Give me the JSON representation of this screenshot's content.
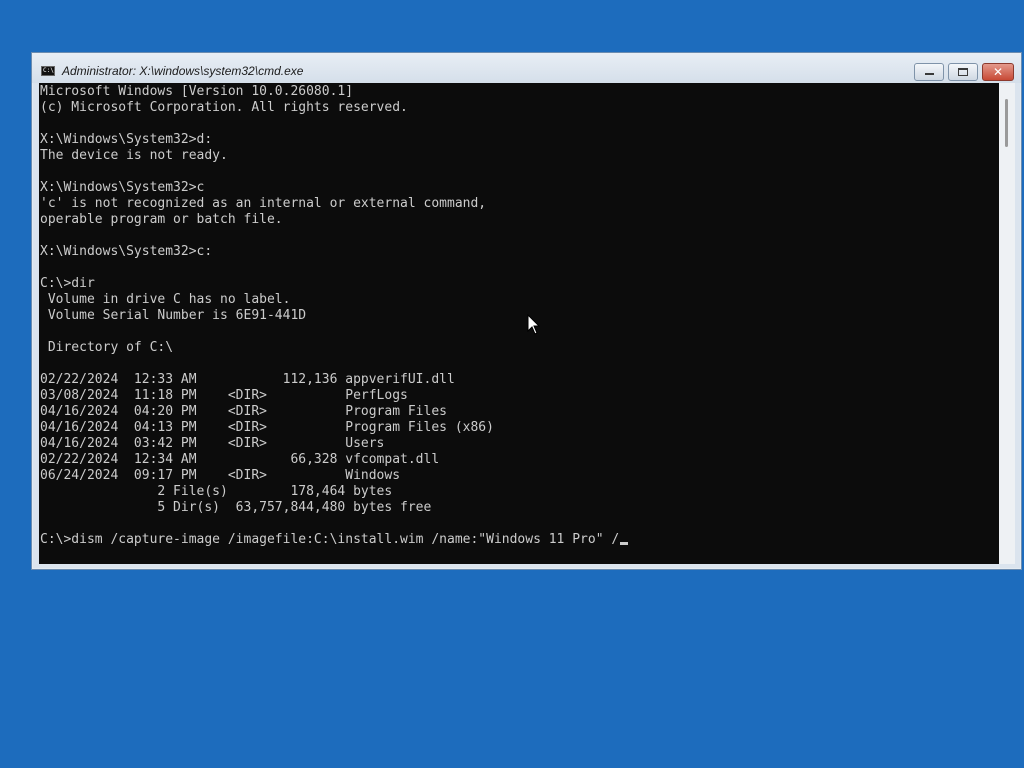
{
  "window": {
    "title": "Administrator: X:\\windows\\system32\\cmd.exe",
    "icon": "cmd-icon",
    "icon_text": "C:\\",
    "close_glyph": "✕"
  },
  "console": {
    "lines": [
      "Microsoft Windows [Version 10.0.26080.1]",
      "(c) Microsoft Corporation. All rights reserved.",
      "",
      "X:\\Windows\\System32>d:",
      "The device is not ready.",
      "",
      "X:\\Windows\\System32>c",
      "'c' is not recognized as an internal or external command,",
      "operable program or batch file.",
      "",
      "X:\\Windows\\System32>c:",
      "",
      "C:\\>dir",
      " Volume in drive C has no label.",
      " Volume Serial Number is 6E91-441D",
      "",
      " Directory of C:\\",
      "",
      "02/22/2024  12:33 AM           112,136 appverifUI.dll",
      "03/08/2024  11:18 PM    <DIR>          PerfLogs",
      "04/16/2024  04:20 PM    <DIR>          Program Files",
      "04/16/2024  04:13 PM    <DIR>          Program Files (x86)",
      "04/16/2024  03:42 PM    <DIR>          Users",
      "02/22/2024  12:34 AM            66,328 vfcompat.dll",
      "06/24/2024  09:17 PM    <DIR>          Windows",
      "               2 File(s)        178,464 bytes",
      "               5 Dir(s)  63,757,844,480 bytes free",
      ""
    ],
    "prompt_line": "C:\\>dism /capture-image /imagefile:C:\\install.wim /name:\"Windows 11 Pro\" /",
    "text_color": "#cccccc",
    "background_color": "#0c0c0c"
  },
  "desktop": {
    "background_color": "#1d6cbd"
  }
}
